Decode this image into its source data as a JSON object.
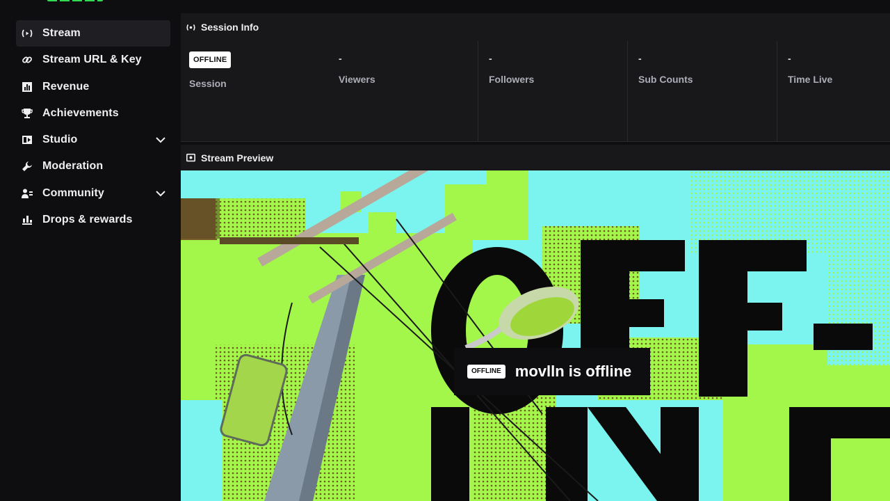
{
  "sidebar": {
    "items": [
      {
        "label": "Stream",
        "icon": "broadcast-icon",
        "active": true
      },
      {
        "label": "Stream URL & Key",
        "icon": "link-icon"
      },
      {
        "label": "Revenue",
        "icon": "bar-chart-icon"
      },
      {
        "label": "Achievements",
        "icon": "trophy-icon"
      },
      {
        "label": "Studio",
        "icon": "studio-icon",
        "expandable": true
      },
      {
        "label": "Moderation",
        "icon": "wrench-icon"
      },
      {
        "label": "Community",
        "icon": "people-icon",
        "expandable": true
      },
      {
        "label": "Drops & rewards",
        "icon": "drops-icon"
      }
    ]
  },
  "session_info": {
    "title": "Session Info",
    "badge": "OFFLINE",
    "session_label": "Session",
    "stats": [
      {
        "value": "-",
        "label": "Viewers"
      },
      {
        "value": "-",
        "label": "Followers"
      },
      {
        "value": "-",
        "label": "Sub Counts"
      },
      {
        "value": "-",
        "label": "Time Live"
      }
    ]
  },
  "preview": {
    "title": "Stream Preview",
    "badge": "OFFLINE",
    "message": "movlln is offline"
  },
  "colors": {
    "accent_green": "#a3f74a",
    "sky": "#7bf3ee",
    "panel_bg": "#18181b",
    "page_bg": "#0e0e10"
  }
}
